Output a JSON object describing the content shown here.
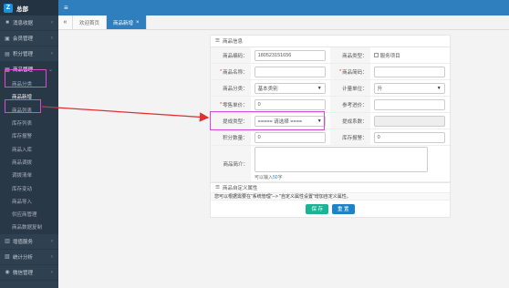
{
  "brand": {
    "title": "总部",
    "logo_letter": "Z"
  },
  "sidebar": {
    "items": [
      {
        "label": "消息收据",
        "icon": "home-icon"
      },
      {
        "label": "会员管理",
        "icon": "user-icon"
      },
      {
        "label": "积分管理",
        "icon": "gift-icon"
      },
      {
        "label": "商品管理",
        "icon": "goods-icon",
        "active": true
      }
    ],
    "submenu": [
      "商品分类",
      "商品新增",
      "商品列表",
      "库存列表",
      "库存报警",
      "商品入库",
      "商品调拨",
      "调拨清单",
      "库存变动",
      "商品导入",
      "供应商管理",
      "商品数据复制"
    ],
    "bottom_items": [
      {
        "label": "增值服务",
        "icon": "star-icon"
      },
      {
        "label": "统计分析",
        "icon": "chart-icon"
      },
      {
        "label": "微信管理",
        "icon": "wechat-icon"
      }
    ]
  },
  "tabs": {
    "home": "欢迎首页",
    "current": "商品新增"
  },
  "form": {
    "section_title": "商品信息",
    "labels": {
      "code": "商品编码：",
      "type": "商品类型：",
      "name": "商品名称：",
      "abbr": "商品简码：",
      "category": "商品分类：",
      "unit": "计量单位：",
      "retail_price": "零售单价：",
      "ref_price": "参考进价：",
      "commission_type": "提成类型：",
      "commission_rate": "提成系数：",
      "points": "积分数量：",
      "stock_alarm": "库存报警：",
      "desc": "商品简介："
    },
    "values": {
      "code": "180523151656",
      "type_option": "服务项目",
      "category": "基本类别",
      "unit": "升",
      "retail_price": "0",
      "commission_type": "===== 请选择 ====",
      "points": "0",
      "stock_alarm": "0"
    },
    "hint_prefix": "可以输入",
    "hint_count": "50",
    "hint_suffix": "字",
    "custom_section": "商品自定义属性",
    "notice": "您可以根据需要在\"系统管理\"--> \"自定义属性设置\"增加自定义属性。",
    "save_label": "保 存",
    "reset_label": "重 置"
  },
  "colors": {
    "sidebar_bg": "#2f4050",
    "topbar": "#2f7fbf",
    "highlight": "#d64ad6",
    "arrow": "#e03030",
    "save": "#1ab394",
    "reset": "#1c84c6"
  }
}
